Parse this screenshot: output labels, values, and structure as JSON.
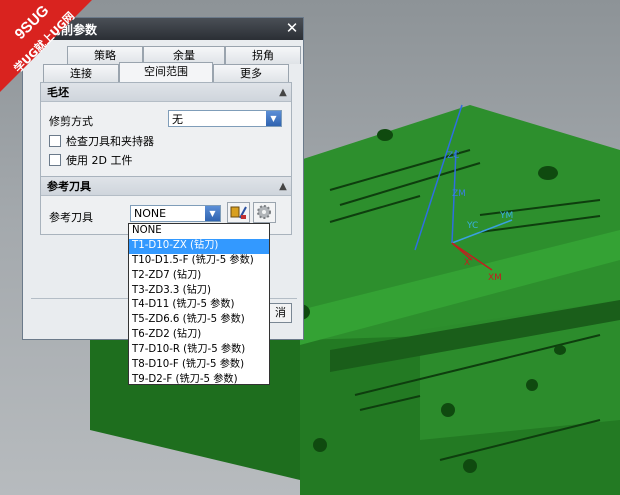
{
  "watermark": {
    "line1": "9SUG",
    "line2": "学UG就上UG网"
  },
  "dialog": {
    "title": "切削参数",
    "close": "✕",
    "tabs_row1": [
      "策略",
      "余量",
      "拐角"
    ],
    "tabs_row2": [
      "连接",
      "空间范围",
      "更多"
    ],
    "active_tab": "空间范围"
  },
  "blank_group": {
    "title": "毛坯",
    "trim_label": "修剪方式",
    "trim_value": "无",
    "check_tool": "检查刀具和夹持器",
    "use_2d": "使用 2D 工件"
  },
  "ref_group": {
    "title": "参考刀具",
    "ref_label": "参考刀具",
    "ref_value": "NONE"
  },
  "dropdown": {
    "options": [
      "NONE",
      "T1-D10-ZX (钻刀)",
      "T10-D1.5-F (铣刀-5 参数)",
      "T2-ZD7 (钻刀)",
      "T3-ZD3.3 (钻刀)",
      "T4-D11 (铣刀-5 参数)",
      "T5-ZD6.6 (铣刀-5 参数)",
      "T6-ZD2 (钻刀)",
      "T7-D10-R (铣刀-5 参数)",
      "T8-D10-F (铣刀-5 参数)",
      "T9-D2-F (铣刀-5 参数)"
    ],
    "selected_index": 1
  },
  "hidden_button_fragment": "消",
  "viewport": {
    "axes": {
      "zc": "ZC",
      "zm": "ZM",
      "yc": "YC",
      "ym": "YM",
      "x": "X",
      "xm": "XM"
    }
  },
  "colors": {
    "part_green": "#1f7a1f",
    "highlight": "#3399ff",
    "watermark_red": "#d9231f"
  }
}
